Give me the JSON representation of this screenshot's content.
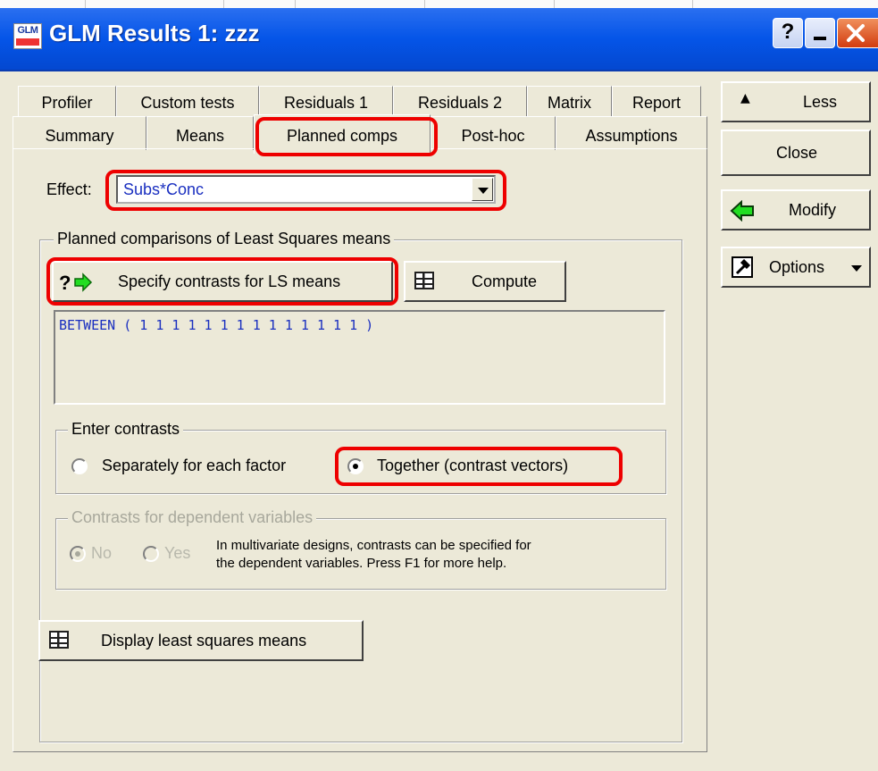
{
  "window": {
    "title": "GLM Results 1: zzz",
    "icon_label": "GLM",
    "caption_help": "?",
    "caption_minimize": "_"
  },
  "tabs_row1": [
    "Profiler",
    "Custom tests",
    "Residuals 1",
    "Residuals 2",
    "Matrix",
    "Report"
  ],
  "tabs_row2": [
    "Summary",
    "Means",
    "Planned comps",
    "Post-hoc",
    "Assumptions"
  ],
  "active_tab": "Planned comps",
  "effect": {
    "label": "Effect:",
    "value": "Subs*Conc"
  },
  "planned_group": {
    "title": "Planned comparisons of Least Squares means",
    "specify_button": "Specify contrasts for LS means",
    "compute_button": "Compute",
    "contrast_text": "BETWEEN ( 1 1 1 1 1 1 1 1 1 1 1 1 1 1 )"
  },
  "enter_contrasts": {
    "title": "Enter contrasts",
    "option_separately": "Separately for each factor",
    "option_together": "Together (contrast vectors)",
    "selected": "together"
  },
  "dependent_contrasts": {
    "title": "Contrasts for dependent variables",
    "option_no": "No",
    "option_yes": "Yes",
    "selected": "no",
    "note_line1": "In multivariate designs, contrasts can be specified for",
    "note_line2": "the dependent variables.  Press F1 for more help."
  },
  "display_button": "Display least squares means",
  "side_buttons": {
    "less": "Less",
    "close": "Close",
    "modify": "Modify",
    "options": "Options"
  },
  "colors": {
    "highlight": "#ee0000",
    "titlebar": "#0555e8",
    "value_text": "#1a2fc0",
    "dialog_bg": "#ece9d8"
  }
}
